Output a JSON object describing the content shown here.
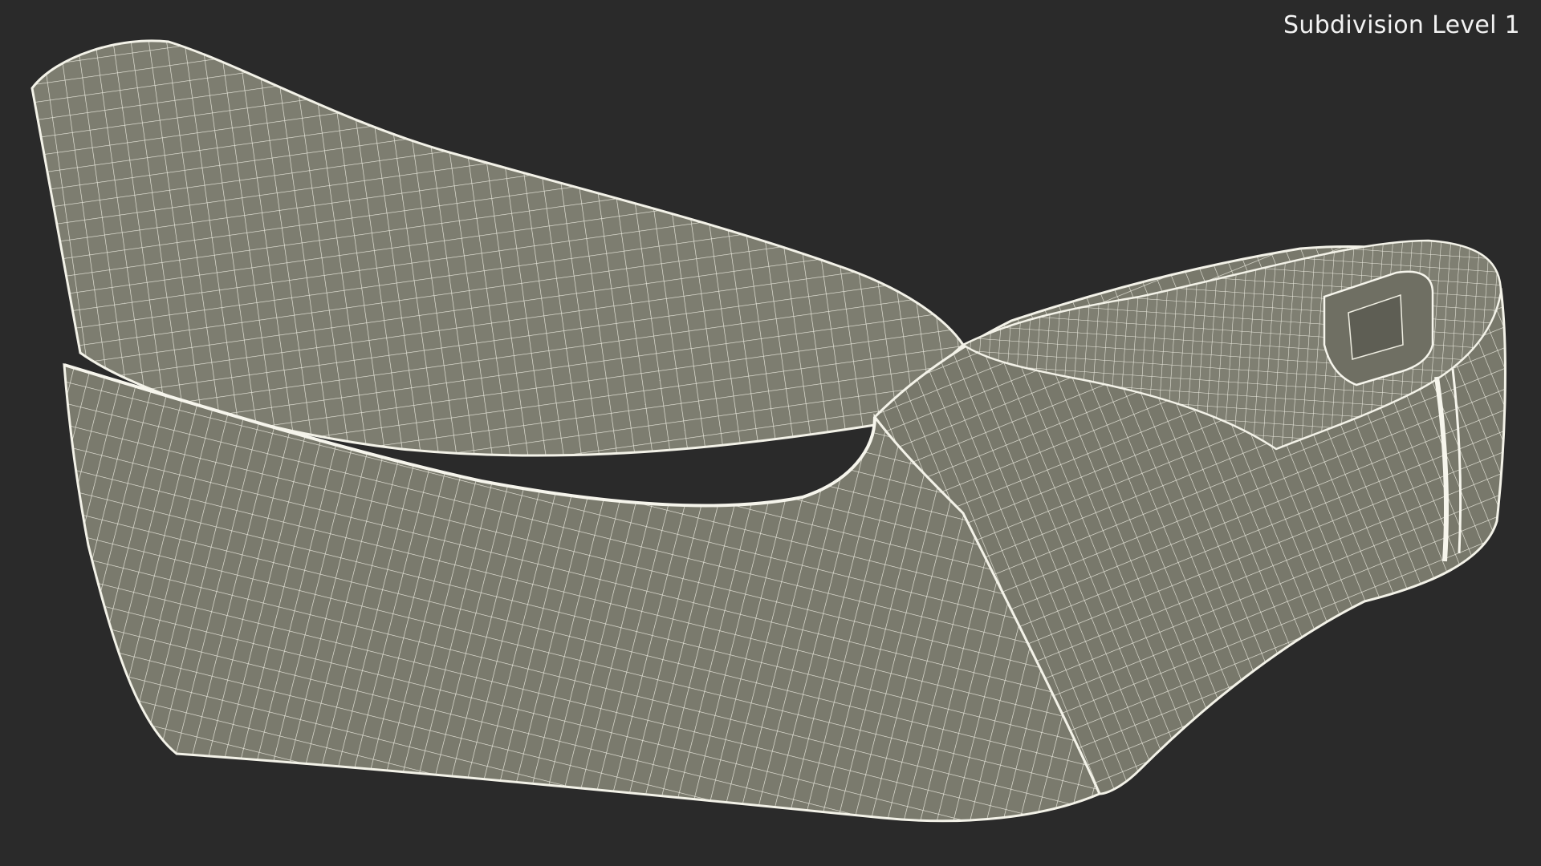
{
  "overlay": {
    "label": "Subdivision Level 1"
  },
  "colors": {
    "background": "#2a2a2a",
    "surface": "#7c7c6f",
    "wire": "#efeee2",
    "edge": "#f6f5ec"
  },
  "scene": {
    "object": "wireframe-mesh",
    "style": "quad-wireframe-over-flat-shaded"
  }
}
